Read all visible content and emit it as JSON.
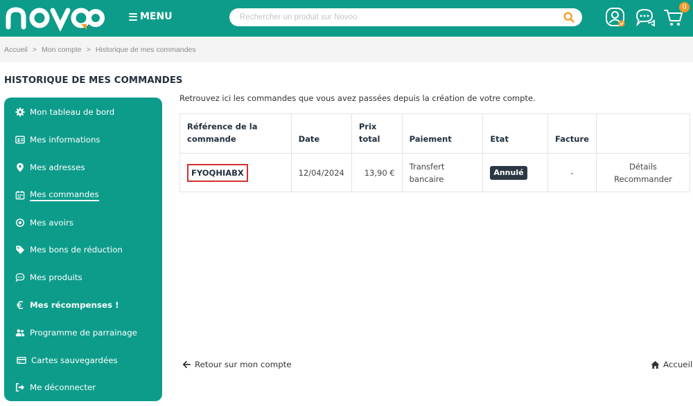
{
  "header": {
    "logo_text": "novoo",
    "menu_label": "MENU",
    "search_placeholder": "Rechercher un produit sur Novoo",
    "cart_count": "0",
    "icons": [
      "account-icon",
      "chat-icon",
      "cart-icon",
      "search-icon"
    ]
  },
  "breadcrumb": {
    "items": [
      "Accueil",
      "Mon compte",
      "Historique de mes commandes"
    ],
    "separator": ">"
  },
  "page_title": "HISTORIQUE DE MES COMMANDES",
  "sidebar": {
    "items": [
      {
        "label": "Mon tableau de bord",
        "icon": "gear-icon"
      },
      {
        "label": "Mes informations",
        "icon": "id-card-icon"
      },
      {
        "label": "Mes adresses",
        "icon": "location-pin-icon"
      },
      {
        "label": "Mes commandes",
        "icon": "calendar-icon",
        "active": true
      },
      {
        "label": "Mes avoirs",
        "icon": "target-icon"
      },
      {
        "label": "Mes bons de réduction",
        "icon": "tag-icon"
      },
      {
        "label": "Mes produits",
        "icon": "speech-bubble-icon"
      },
      {
        "label": "Mes récompenses !",
        "icon": "euro-icon",
        "bold": true
      },
      {
        "label": "Programme de parrainage",
        "icon": "users-icon"
      },
      {
        "label": "Cartes sauvegardées",
        "icon": "credit-card-icon"
      },
      {
        "label": "Me déconnecter",
        "icon": "logout-icon"
      }
    ]
  },
  "intro": "Retrouvez ici les commandes que vous avez passées depuis la création de votre compte.",
  "table": {
    "headers": {
      "ref_line1": "Référence de la",
      "ref_line2": "commande",
      "date": "Date",
      "price_line1": "Prix",
      "price_line2": "total",
      "payment": "Paiement",
      "state": "Etat",
      "invoice": "Facture"
    },
    "rows": [
      {
        "reference": "FYOQHIABX",
        "date": "12/04/2024",
        "total": "13,90 €",
        "payment_line1": "Transfert",
        "payment_line2": "bancaire",
        "state": "Annulé",
        "invoice": "-",
        "actions": [
          "Détails",
          "Recommander"
        ]
      }
    ]
  },
  "footer": {
    "back_label": "Retour sur mon compte",
    "home_label": "Accueil"
  },
  "colors": {
    "brand_teal": "#0d9c8a",
    "accent_orange": "#f39c2a",
    "dark_navy": "#23303d",
    "highlight_red": "#d32f2f"
  }
}
